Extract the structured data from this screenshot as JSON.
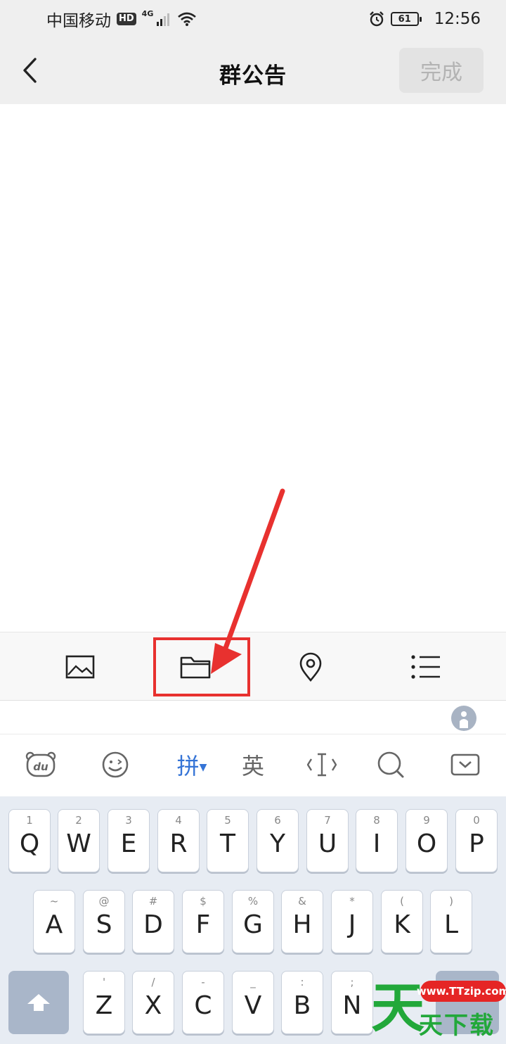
{
  "status_bar": {
    "carrier": "中国移动",
    "hd": "HD",
    "network": "4G",
    "battery": "61",
    "time": "12:56"
  },
  "header": {
    "title": "群公告",
    "done_label": "完成"
  },
  "attach_toolbar": {
    "icons": [
      "image-icon",
      "folder-icon",
      "location-pin-icon",
      "list-icon"
    ]
  },
  "keyboard_toolbar": {
    "pinyin_label": "拼",
    "english_label": "英",
    "du_label": "du"
  },
  "keyboard": {
    "row1": [
      {
        "sym": "1",
        "ch": "Q"
      },
      {
        "sym": "2",
        "ch": "W"
      },
      {
        "sym": "3",
        "ch": "E"
      },
      {
        "sym": "4",
        "ch": "R"
      },
      {
        "sym": "5",
        "ch": "T"
      },
      {
        "sym": "6",
        "ch": "Y"
      },
      {
        "sym": "7",
        "ch": "U"
      },
      {
        "sym": "8",
        "ch": "I"
      },
      {
        "sym": "9",
        "ch": "O"
      },
      {
        "sym": "0",
        "ch": "P"
      }
    ],
    "row2": [
      {
        "sym": "~",
        "ch": "A"
      },
      {
        "sym": "@",
        "ch": "S"
      },
      {
        "sym": "#",
        "ch": "D"
      },
      {
        "sym": "$",
        "ch": "F"
      },
      {
        "sym": "%",
        "ch": "G"
      },
      {
        "sym": "&",
        "ch": "H"
      },
      {
        "sym": "*",
        "ch": "J"
      },
      {
        "sym": "(",
        "ch": "K"
      },
      {
        "sym": ")",
        "ch": "L"
      }
    ],
    "row3": [
      {
        "sym": "'",
        "ch": "Z"
      },
      {
        "sym": "/",
        "ch": "X"
      },
      {
        "sym": "-",
        "ch": "C"
      },
      {
        "sym": "_",
        "ch": "V"
      },
      {
        "sym": ":",
        "ch": "B"
      },
      {
        "sym": ";",
        "ch": "N"
      }
    ]
  },
  "watermark": {
    "url": "www.TTzip.com",
    "big_char": "天",
    "text": "天下载"
  }
}
